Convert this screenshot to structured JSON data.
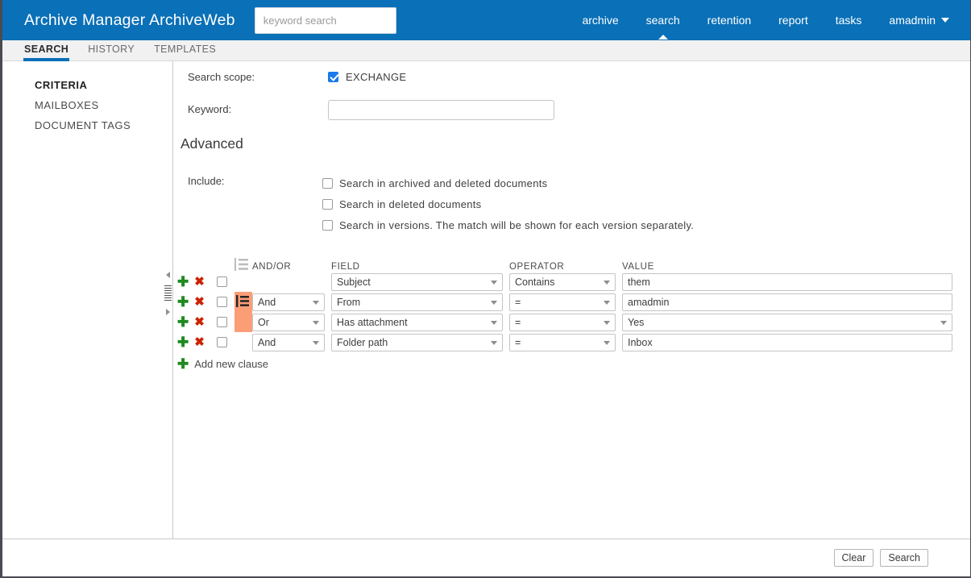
{
  "header": {
    "brand": "Archive Manager ArchiveWeb",
    "search_placeholder": "keyword search",
    "search_value": "",
    "nav": [
      {
        "label": "archive",
        "active": false
      },
      {
        "label": "search",
        "active": true
      },
      {
        "label": "retention",
        "active": false
      },
      {
        "label": "report",
        "active": false
      },
      {
        "label": "tasks",
        "active": false
      }
    ],
    "user": "amadmin",
    "brand_color": "#0a70b7"
  },
  "tabs": [
    {
      "label": "SEARCH",
      "active": true
    },
    {
      "label": "HISTORY",
      "active": false
    },
    {
      "label": "TEMPLATES",
      "active": false
    }
  ],
  "sidebar": {
    "items": [
      {
        "label": "CRITERIA",
        "active": true
      },
      {
        "label": "MAILBOXES",
        "active": false
      },
      {
        "label": "DOCUMENT TAGS",
        "active": false
      }
    ]
  },
  "form": {
    "scope_label": "Search scope:",
    "scope_option": "EXCHANGE",
    "scope_checked": true,
    "keyword_label": "Keyword:",
    "keyword_value": "",
    "advanced_title": "Advanced",
    "include_label": "Include:",
    "include_options": [
      {
        "label": "Search in archived and deleted documents",
        "checked": false
      },
      {
        "label": "Search in deleted documents",
        "checked": false
      },
      {
        "label": "Search in versions. The match will be shown for each version separately.",
        "checked": false
      }
    ]
  },
  "clauses": {
    "columns": {
      "group": "group-icon",
      "andor": "AND/OR",
      "field": "FIELD",
      "operator": "OPERATOR",
      "value": "VALUE"
    },
    "group_color": "#fb9e78",
    "rows": [
      {
        "selected": false,
        "andor": "",
        "andor_visible": false,
        "field": "Subject",
        "operator": "Contains",
        "value": "them",
        "value_is_select": false,
        "grouped": false,
        "group_handle": false
      },
      {
        "selected": false,
        "andor": "And",
        "andor_visible": true,
        "field": "From",
        "operator": "=",
        "value": "amadmin",
        "value_is_select": false,
        "grouped": true,
        "group_handle": true
      },
      {
        "selected": false,
        "andor": "Or",
        "andor_visible": true,
        "field": "Has attachment",
        "operator": "=",
        "value": "Yes",
        "value_is_select": true,
        "grouped": true,
        "group_handle": false
      },
      {
        "selected": false,
        "andor": "And",
        "andor_visible": true,
        "field": "Folder path",
        "operator": "=",
        "value": "Inbox",
        "value_is_select": false,
        "grouped": false,
        "group_handle": false
      }
    ],
    "add_label": "Add new clause",
    "add_icon": "plus-icon",
    "row_add_icon": "plus-icon",
    "row_delete_icon": "cross-icon"
  },
  "footer": {
    "clear_label": "Clear",
    "search_label": "Search"
  }
}
